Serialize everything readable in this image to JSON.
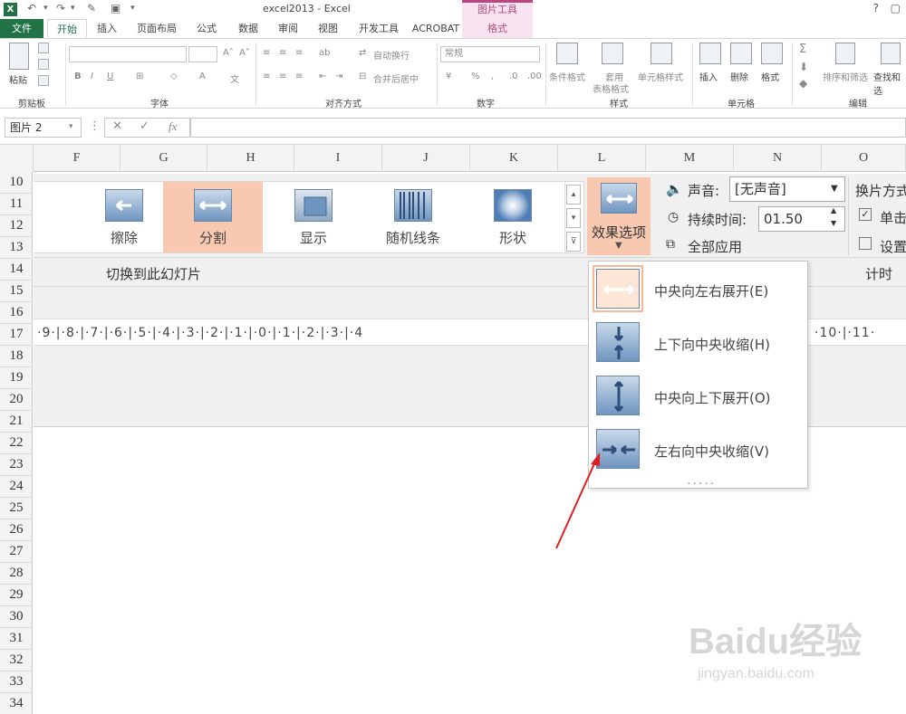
{
  "window": {
    "title": "excel2013 - Excel",
    "context_tools": "图片工具",
    "help": "?"
  },
  "tabs": [
    {
      "label": "文件"
    },
    {
      "label": "开始"
    },
    {
      "label": "插入"
    },
    {
      "label": "页面布局"
    },
    {
      "label": "公式"
    },
    {
      "label": "数据"
    },
    {
      "label": "审阅"
    },
    {
      "label": "视图"
    },
    {
      "label": "开发工具"
    },
    {
      "label": "ACROBAT"
    },
    {
      "label": "格式"
    }
  ],
  "ribbon": {
    "groups": {
      "clipboard": "剪贴板",
      "font": "字体",
      "alignment": "对齐方式",
      "number": "数字",
      "styles": "样式",
      "cells": "单元格",
      "editing": "编辑"
    },
    "paste": "粘贴",
    "wrap_text": "自动换行",
    "merge_center": "合并后居中",
    "number_format": "常规",
    "conditional_format": "条件格式",
    "format_as_table_1": "套用",
    "format_as_table_2": "表格格式",
    "cell_styles": "单元格样式",
    "insert": "插入",
    "delete": "删除",
    "format": "格式",
    "sort_filter": "排序和筛选",
    "find_select": "查找和选"
  },
  "formula_bar": {
    "name_box": "图片 2",
    "fx": "fx"
  },
  "columns": [
    "F",
    "G",
    "H",
    "I",
    "J",
    "K",
    "L",
    "M",
    "N",
    "O"
  ],
  "rows": [
    "10",
    "11",
    "12",
    "13",
    "14",
    "15",
    "16",
    "17",
    "18",
    "19",
    "20",
    "21",
    "22",
    "23",
    "24",
    "25",
    "26",
    "27",
    "28",
    "29",
    "30",
    "31",
    "32",
    "33",
    "34"
  ],
  "picture": {
    "transitions": [
      {
        "label": "擦除"
      },
      {
        "label": "分割"
      },
      {
        "label": "显示"
      },
      {
        "label": "随机线条"
      },
      {
        "label": "形状"
      }
    ],
    "section_title": "切换到此幻灯片",
    "timing_title": "计时",
    "effect_options": "效果选项",
    "sound_label": "声音:",
    "sound_value": "[无声音]",
    "duration_label": "持续时间:",
    "duration_value": "01.50",
    "apply_all": "全部应用",
    "advance_title": "换片方式",
    "on_click": "单击",
    "after": "设置",
    "ruler": "·9·|·8·|·7·|·6·|·5·|·4·|·3·|·2·|·1·|·0·|·1·|·2·|·3·|·4",
    "ruler_right": "·10·|·11·"
  },
  "menu": {
    "items": [
      {
        "label": "中央向左右展开(E)"
      },
      {
        "label": "上下向中央收缩(H)"
      },
      {
        "label": "中央向上下展开(O)"
      },
      {
        "label": "左右向中央收缩(V)"
      }
    ],
    "more": "....."
  },
  "watermark": {
    "brand": "Baidu经验",
    "url": "jingyan.baidu.com"
  },
  "colors": {
    "excel_green": "#217346",
    "context_pink": "#b9467e",
    "selected_orange": "#f9c8b0",
    "annotation_red": "#e02020"
  }
}
